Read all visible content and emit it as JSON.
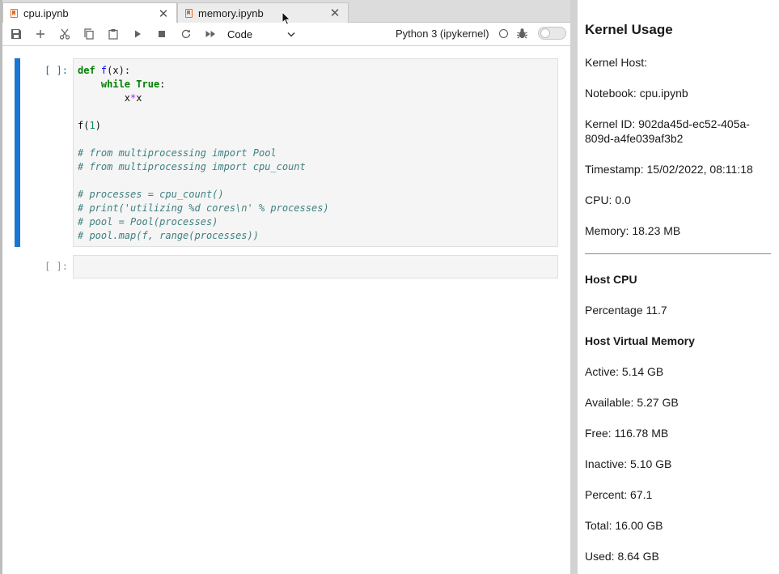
{
  "tabs": [
    {
      "label": "cpu.ipynb",
      "active": true
    },
    {
      "label": "memory.ipynb",
      "active": false
    }
  ],
  "toolbar": {
    "icons": [
      "save-icon",
      "add-icon",
      "cut-icon",
      "copy-icon",
      "paste-icon",
      "run-icon",
      "stop-icon",
      "restart-icon",
      "fast-forward-icon"
    ],
    "cell_type": "Code",
    "kernel_name": "Python 3 (ipykernel)"
  },
  "cells": [
    {
      "prompt": "[ ]:",
      "lines": [
        "def f(x):",
        "    while True:",
        "        x*x",
        "",
        "f(1)",
        "",
        "# from multiprocessing import Pool",
        "# from multiprocessing import cpu_count",
        "",
        "# processes = cpu_count()",
        "# print('utilizing %d cores\\n' % processes)",
        "# pool = Pool(processes)",
        "# pool.map(f, range(processes))"
      ]
    },
    {
      "prompt": "[ ]:",
      "lines": []
    }
  ],
  "kernel_usage": {
    "title": "Kernel Usage",
    "kernel_host": "Kernel Host:",
    "notebook": "Notebook: cpu.ipynb",
    "kernel_id_line1": "Kernel ID: 902da45d-ec52-405a-",
    "kernel_id_line2": "809d-a4fe039af3b2",
    "timestamp": "Timestamp: 15/02/2022, 08:11:18",
    "cpu": "CPU: 0.0",
    "memory": "Memory: 18.23 MB",
    "host_cpu_heading": "Host CPU",
    "percentage": "Percentage 11.7",
    "host_vm_heading": "Host Virtual Memory",
    "active": "Active: 5.14 GB",
    "available": "Available: 5.27 GB",
    "free": "Free: 116.78 MB",
    "inactive": "Inactive: 5.10 GB",
    "percent": "Percent: 67.1",
    "total": "Total: 16.00 GB",
    "used": "Used: 8.64 GB"
  },
  "colors": {
    "active_cell_bar": "#1976d2",
    "notebook_icon": "#e46e2e",
    "keyword": "#008000",
    "comment": "#408080"
  }
}
